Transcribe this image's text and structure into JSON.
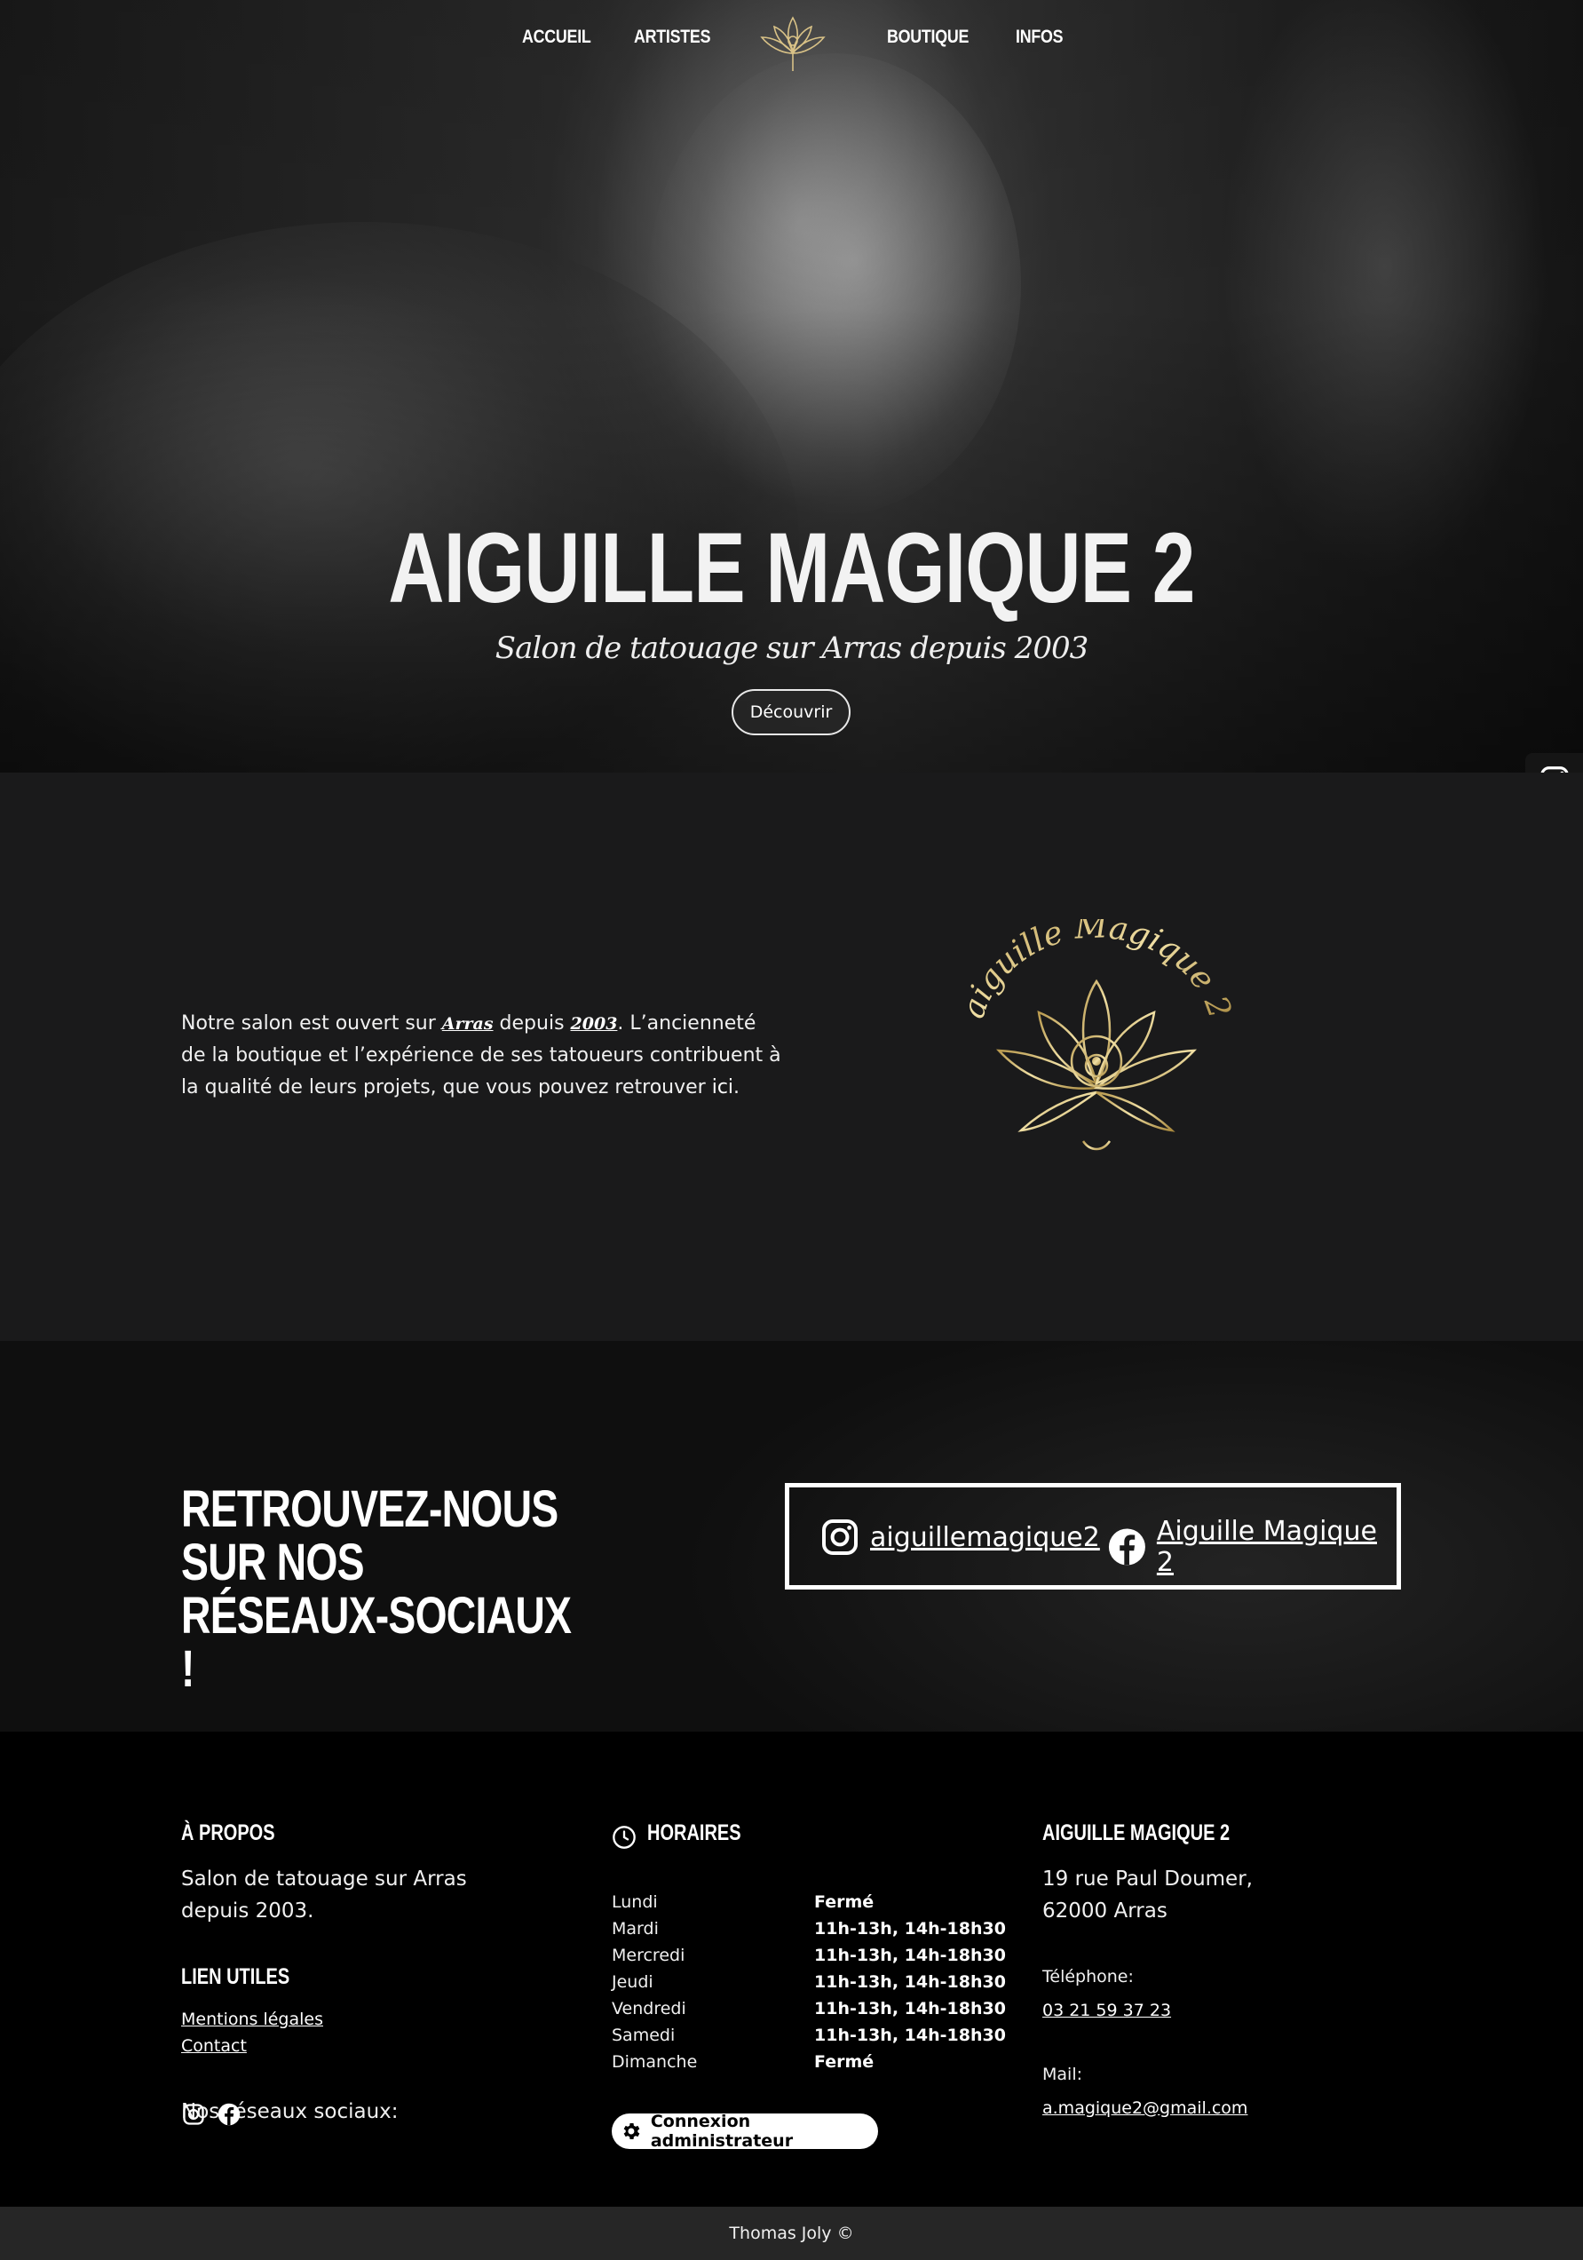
{
  "nav": {
    "home": "ACCUEIL",
    "artists": "ARTISTES",
    "shop": "BOUTIQUE",
    "info": "INFOS"
  },
  "hero": {
    "title": "AIGUILLE MAGIQUE 2",
    "subtitle": "Salon de tatouage sur Arras depuis 2003",
    "button": "Découvrir"
  },
  "about": {
    "p1": "Notre salon est ouvert sur ",
    "city": "Arras",
    "p2": " depuis ",
    "year": "2003",
    "p3": ". L’ancienneté de la boutique et l’expérience de ses tatoueurs contribuent à la qualité de leurs projets, que vous pouvez retrouver ",
    "link": "ici",
    "p4": ".",
    "logo_text": "aiguille Magique 2"
  },
  "social_section": {
    "heading_line1": "RETROUVEZ-NOUS SUR NOS",
    "heading_line2": "RÉSEAUX-SOCIAUX !",
    "instagram": "aiguillemagique2",
    "facebook": "Aiguille Magique 2"
  },
  "footer": {
    "about_title": "À PROPOS",
    "about_text": "Salon de tatouage sur Arras depuis 2003.",
    "links_title": "LIEN UTILES",
    "legal": "Mentions légales",
    "contact": "Contact",
    "social_label": "Nos réseaux sociaux:",
    "hours_title": "HORAIRES",
    "hours": [
      {
        "day": "Lundi",
        "time": "Fermé"
      },
      {
        "day": "Mardi",
        "time": "11h-13h, 14h-18h30"
      },
      {
        "day": "Mercredi",
        "time": "11h-13h, 14h-18h30"
      },
      {
        "day": "Jeudi",
        "time": "11h-13h, 14h-18h30"
      },
      {
        "day": "Vendredi",
        "time": "11h-13h, 14h-18h30"
      },
      {
        "day": "Samedi",
        "time": "11h-13h, 14h-18h30"
      },
      {
        "day": "Dimanche",
        "time": "Fermé"
      }
    ],
    "admin_button": "Connexion administrateur",
    "shop_title": "AIGUILLE MAGIQUE 2",
    "address_line1": "19 rue Paul Doumer,",
    "address_line2": "62000 Arras",
    "phone_label": "Téléphone:",
    "phone": "03 21 59 37 23",
    "mail_label": "Mail:",
    "mail": "a.magique2@gmail.com"
  },
  "copyright": "Thomas Joly ©",
  "colors": {
    "gold": "#d9c287",
    "dark_bg": "#1a1a1b",
    "footer_bg": "#000000"
  },
  "icons": [
    "lotus-logo-icon",
    "instagram-icon",
    "facebook-icon",
    "clock-icon",
    "gear-icon"
  ]
}
